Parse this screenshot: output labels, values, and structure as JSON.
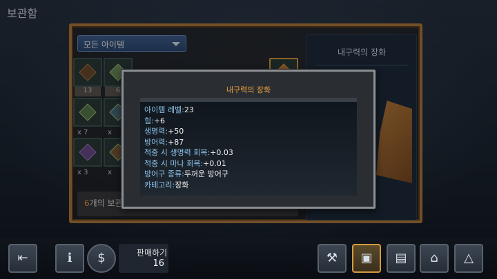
{
  "screen": {
    "title": "보관함"
  },
  "storage": {
    "filter_label": "모든 아이템",
    "slot_counts": [
      "13",
      "6"
    ],
    "row2_counts": [
      "x 7",
      "x"
    ],
    "row3_counts": [
      "x 3",
      "x"
    ],
    "info_num": "6",
    "info_text": "개의 보관"
  },
  "side_panel": {
    "title": "내구력의 장화"
  },
  "tooltip": {
    "title": "내구력의 장화",
    "stats": [
      {
        "key": "아이템 레벨:",
        "value": "23"
      },
      {
        "key": "힘:",
        "value": "+6"
      },
      {
        "key": "생명력:",
        "value": "+50"
      },
      {
        "key": "방어력:",
        "value": "+87"
      },
      {
        "key": "적중 시 생명력 회복:",
        "value": "+0.03"
      },
      {
        "key": "적중 시 마나 회복:",
        "value": "+0.01"
      },
      {
        "key": "방어구 종류:",
        "value": "두꺼운 방어구"
      },
      {
        "key": "카테고리:",
        "value": "장화"
      }
    ]
  },
  "bottom": {
    "sell_label": "판매하기",
    "sell_count": "16"
  },
  "colors": {
    "accent": "#f2a23c",
    "stat_key": "#8fc6ee",
    "frame": "#b07a3e"
  }
}
